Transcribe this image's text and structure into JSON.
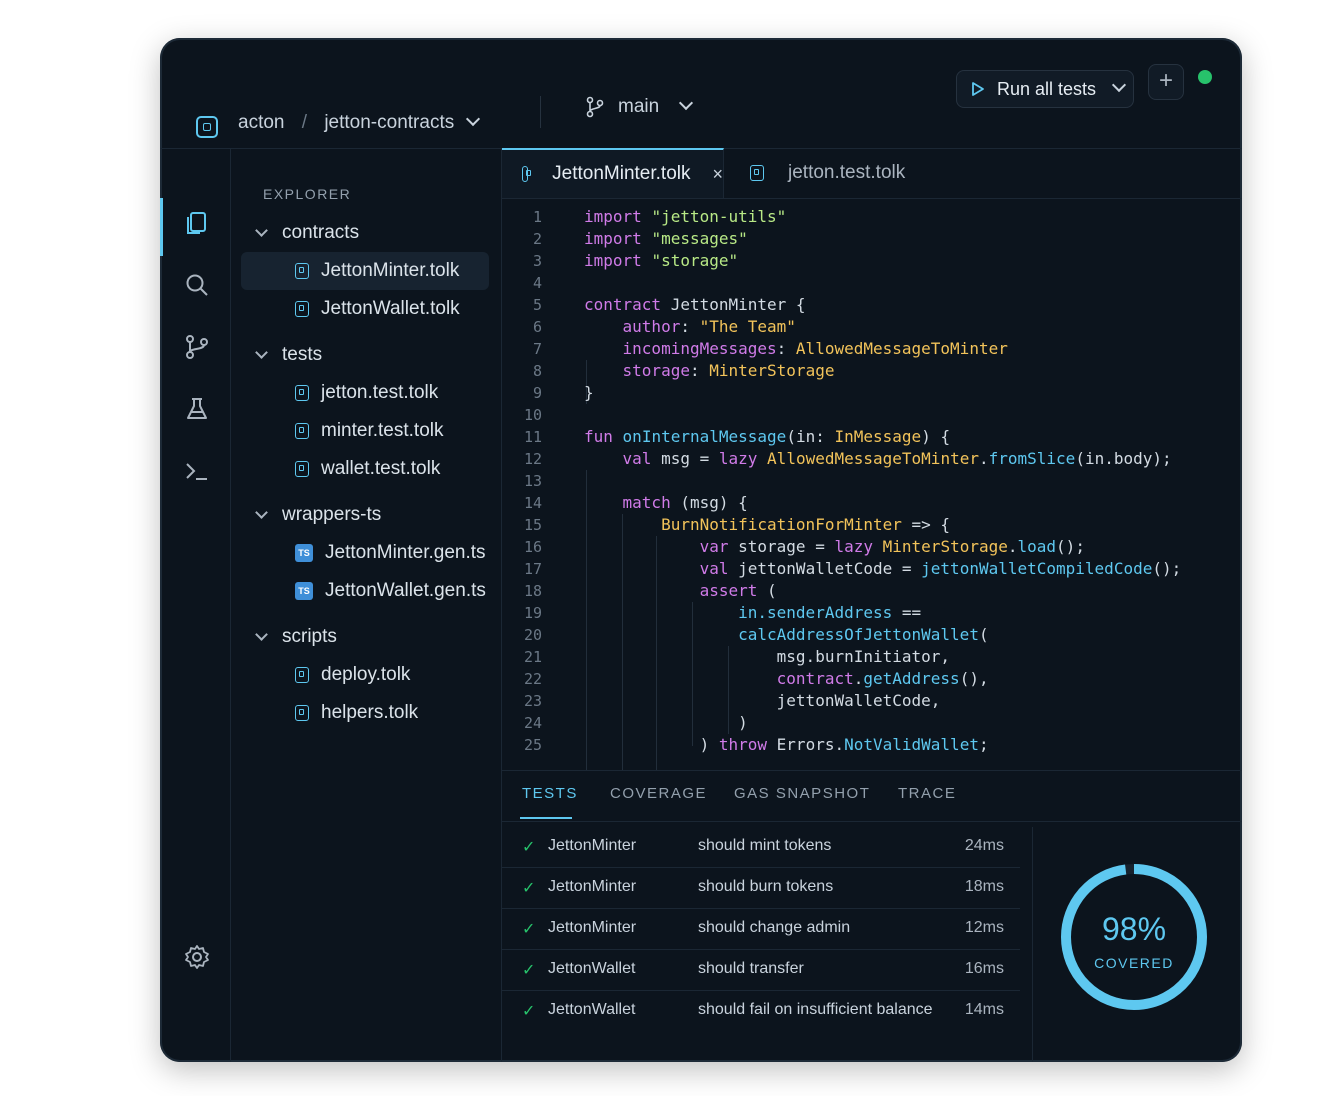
{
  "colors": {
    "accent": "#5ec8f0",
    "success": "#27c26b",
    "background": "#0c141d",
    "keyword": "#d07be8",
    "string": "#b8e986",
    "type": "#f2c35a"
  },
  "header": {
    "org": "acton",
    "separator": "/",
    "repo": "jetton-contracts",
    "branch": "main",
    "run_label": "Run all tests",
    "add_label": "+"
  },
  "activity_bar": {
    "icons": [
      "files-icon",
      "search-icon",
      "source-control-icon",
      "beaker-icon",
      "terminal-icon",
      "settings-icon"
    ]
  },
  "explorer": {
    "title": "EXPLORER",
    "folders": [
      {
        "name": "contracts",
        "files": [
          "JettonMinter.tolk",
          "JettonWallet.tolk"
        ]
      },
      {
        "name": "tests",
        "files": [
          "jetton.test.tolk",
          "minter.test.tolk",
          "wallet.test.tolk"
        ]
      },
      {
        "name": "wrappers-ts",
        "files": [
          "JettonMinter.gen.ts",
          "JettonWallet.gen.ts"
        ]
      },
      {
        "name": "scripts",
        "files": [
          "deploy.tolk",
          "helpers.tolk"
        ]
      }
    ]
  },
  "editor": {
    "tabs": [
      {
        "label": "JettonMinter.tolk",
        "close": "×"
      },
      {
        "label": "jetton.test.tolk"
      }
    ],
    "line_numbers": [
      "1",
      "2",
      "3",
      "4",
      "5",
      "6",
      "7",
      "8",
      "9",
      "10",
      "11",
      "12",
      "13",
      "14",
      "15",
      "16",
      "17",
      "18",
      "19",
      "20",
      "21",
      "22",
      "23",
      "24",
      "25"
    ]
  },
  "panel": {
    "tabs": [
      "TESTS",
      "COVERAGE",
      "GAS SNAPSHOT",
      "TRACE"
    ],
    "results": [
      {
        "suite": "JettonMinter",
        "name": "should mint tokens",
        "time": "24ms"
      },
      {
        "suite": "JettonMinter",
        "name": "should burn tokens",
        "time": "18ms"
      },
      {
        "suite": "JettonMinter",
        "name": "should change admin",
        "time": "12ms"
      },
      {
        "suite": "JettonWallet",
        "name": "should transfer",
        "time": "16ms"
      },
      {
        "suite": "JettonWallet",
        "name": "should fail on insufficient balance",
        "time": "14ms"
      }
    ],
    "coverage": {
      "percent_text": "98%",
      "label": "COVERED",
      "value": 0.98
    }
  }
}
